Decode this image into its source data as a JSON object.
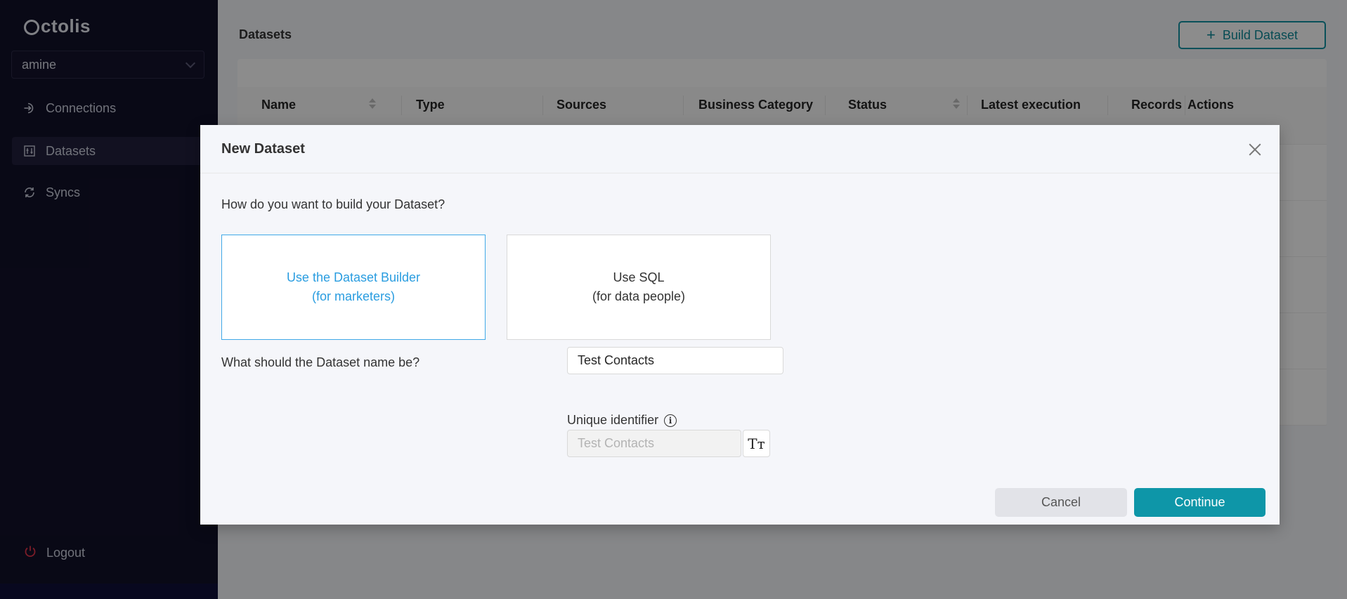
{
  "app": {
    "logo_text": "ctolis"
  },
  "sidebar": {
    "account": "amine",
    "items": [
      {
        "label": "Connections",
        "icon": "login-icon"
      },
      {
        "label": "Datasets",
        "icon": "dataset-icon",
        "active": true
      },
      {
        "label": "Syncs",
        "icon": "sync-icon"
      }
    ],
    "logout_label": "Logout"
  },
  "page": {
    "title": "Datasets",
    "build_button": "Build Dataset"
  },
  "table": {
    "columns": [
      "Name",
      "Type",
      "Sources",
      "Business Category",
      "Status",
      "Latest execution",
      "Records",
      "Actions"
    ]
  },
  "modal": {
    "title": "New Dataset",
    "build_question": "How do you want to build your Dataset?",
    "options": [
      {
        "line1": "Use the Dataset Builder",
        "line2": "(for marketers)",
        "selected": true
      },
      {
        "line1": "Use SQL",
        "line2": "(for data people)",
        "selected": false
      }
    ],
    "name_question": "What should the Dataset name be?",
    "name_value": "Test Contacts",
    "uid_label": "Unique identifier",
    "uid_value": "Test Contacts",
    "case_button": "Tт",
    "cancel_label": "Cancel",
    "continue_label": "Continue"
  },
  "colors": {
    "sidebar_bg": "#121129",
    "accent": "#0e96a8",
    "selected_option": "#2a9de0",
    "danger": "#e0344a"
  }
}
